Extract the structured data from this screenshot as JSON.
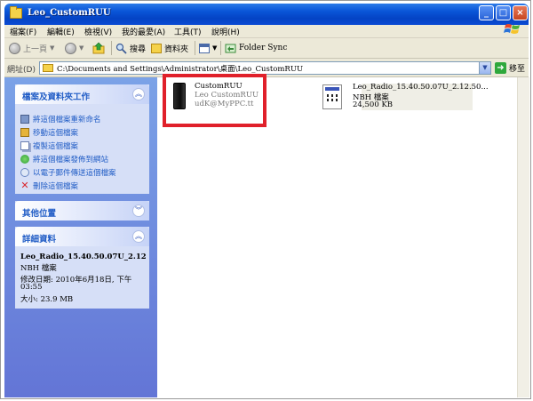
{
  "window": {
    "title": "Leo_CustomRUU",
    "minimize": "_",
    "maximize": "□",
    "close": "×"
  },
  "menu": [
    "檔案(F)",
    "編輯(E)",
    "檢視(V)",
    "我的最愛(A)",
    "工具(T)",
    "說明(H)"
  ],
  "toolbar": {
    "back": "上一頁",
    "search": "搜尋",
    "folders": "資料夾",
    "folder_sync": "Folder Sync"
  },
  "address": {
    "label": "網址(D)",
    "path": "C:\\Documents and Settings\\Administrator\\桌面\\Leo_CustomRUU",
    "go": "移至"
  },
  "tasks": {
    "header": "檔案及資料夾工作",
    "items": [
      {
        "label": "將這個檔案重新命名",
        "icon": "rename-icon",
        "color": "#7d97c9"
      },
      {
        "label": "移動這個檔案",
        "icon": "move-icon",
        "color": "#e6b43a"
      },
      {
        "label": "複製這個檔案",
        "icon": "copy-icon",
        "color": "#9aa9cf"
      },
      {
        "label": "將這個檔案發佈到網站",
        "icon": "publish-icon",
        "color": "#2f9e3a"
      },
      {
        "label": "以電子郵件傳送這個檔案",
        "icon": "email-icon",
        "color": "#8fa9d8"
      },
      {
        "label": "刪除這個檔案",
        "icon": "delete-icon",
        "color": "#d9272e"
      }
    ]
  },
  "other_places": {
    "header": "其他位置"
  },
  "details": {
    "header": "詳細資料",
    "name": "Leo_Radio_15.40.50.07U_2.12",
    "type": "NBH 檔案",
    "modified_line1": "修改日期: 2010年6月18日, 下午",
    "modified_line2": "03:55",
    "size": "大小: 23.9 MB"
  },
  "files": [
    {
      "name": "CustomRUU",
      "line2": "Leo CustomRUU",
      "line3": "udK@MyPPC.tt",
      "icon": "phone-icon"
    },
    {
      "name": "Leo_Radio_15.40.50.07U_2.12.50...",
      "line2": "NBH 檔案",
      "line3": "24,500 KB",
      "icon": "nbh-file-icon"
    }
  ],
  "colors": {
    "titlebar": "#0a56d8",
    "taskpane": "#6f8fe0",
    "link": "#215dc6",
    "highlight": "#e0202a"
  }
}
